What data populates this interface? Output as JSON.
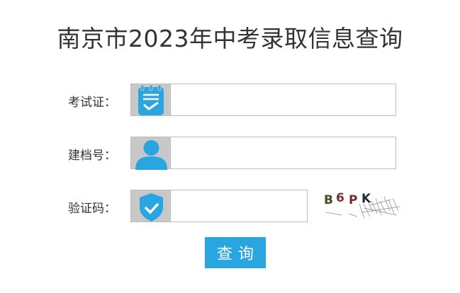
{
  "page": {
    "title": "南京市2023年中考录取信息查询"
  },
  "form": {
    "exam_id": {
      "label": "考试证：",
      "value": "",
      "icon": "clipboard-check-icon"
    },
    "archive_id": {
      "label": "建档号：",
      "value": "",
      "icon": "user-icon"
    },
    "captcha": {
      "label": "验证码：",
      "value": "",
      "icon": "shield-check-icon",
      "image_text": "B6PK"
    },
    "submit_label": "查询"
  },
  "colors": {
    "accent": "#29a6e0",
    "icon_bg": "#c8c8c8",
    "title_text": "#333333"
  }
}
